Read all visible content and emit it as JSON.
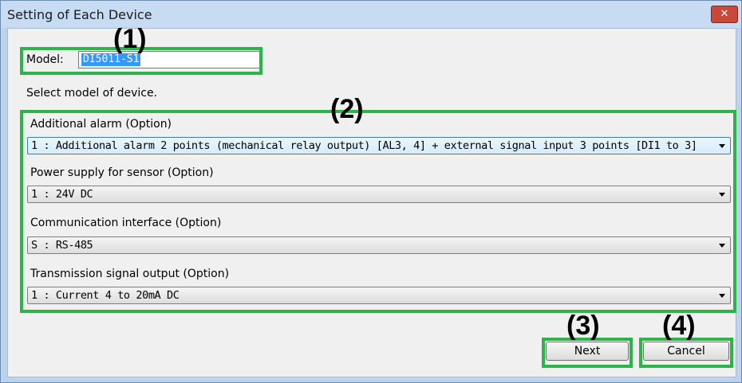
{
  "window": {
    "title": "Setting of Each Device",
    "close_glyph": "✕",
    "close_icon": "close-icon"
  },
  "model": {
    "label": "Model:",
    "value": "DI5011-S1"
  },
  "hint": "Select model of device.",
  "options": [
    {
      "label": "Additional alarm (Option)",
      "value": "1 : Additional alarm 2 points (mechanical relay output) [AL3, 4] + external signal input 3 points [DI1 to 3]"
    },
    {
      "label": "Power supply for sensor (Option)",
      "value": "1 : 24V DC"
    },
    {
      "label": "Communication interface (Option)",
      "value": "S : RS-485"
    },
    {
      "label": "Transmission signal output (Option)",
      "value": "1 : Current 4  to  20mA DC"
    }
  ],
  "buttons": {
    "next": "Next",
    "cancel": "Cancel"
  },
  "callouts": [
    "(1)",
    "(2)",
    "(3)",
    "(4)"
  ],
  "colors": {
    "highlight": "#2db34a",
    "selection": "#3399ff",
    "close_button": "#c8493a"
  }
}
